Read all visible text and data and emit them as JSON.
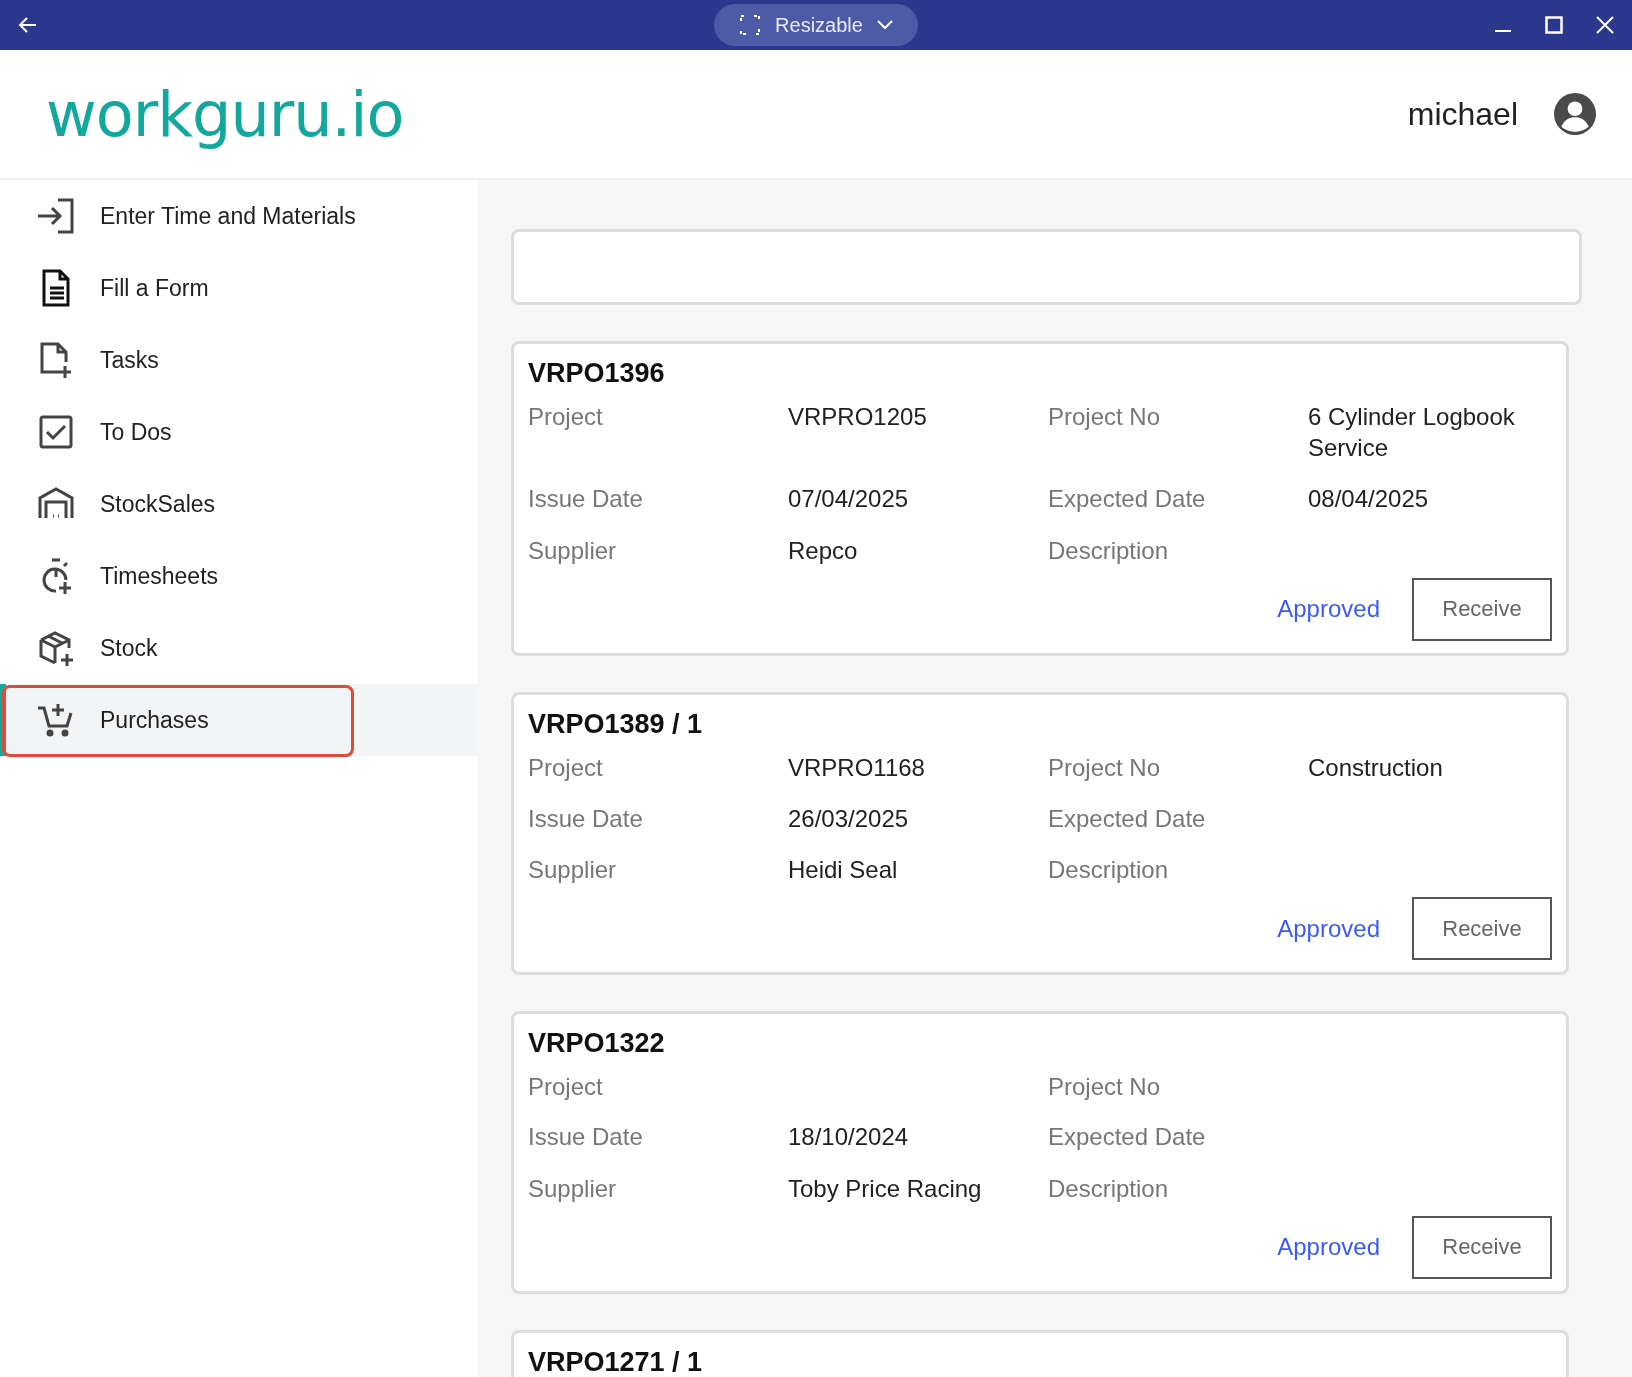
{
  "window": {
    "resize_mode": "Resizable"
  },
  "header": {
    "logo": "workguru.io",
    "user": "michael"
  },
  "sidebar": {
    "items": [
      {
        "label": "Enter Time and Materials",
        "selected": false
      },
      {
        "label": "Fill a Form",
        "selected": false
      },
      {
        "label": "Tasks",
        "selected": false
      },
      {
        "label": "To Dos",
        "selected": false
      },
      {
        "label": "StockSales",
        "selected": false
      },
      {
        "label": "Timesheets",
        "selected": false
      },
      {
        "label": "Stock",
        "selected": false
      },
      {
        "label": "Purchases",
        "selected": true
      }
    ]
  },
  "purchases": [
    {
      "title": "VRPO1396",
      "fields": [
        {
          "label": "Project",
          "value": "VRPRO1205"
        },
        {
          "label": "Project No",
          "value": "6 Cylinder Logbook Service"
        },
        {
          "label": "Issue Date",
          "value": "07/04/2025"
        },
        {
          "label": "Expected Date",
          "value": "08/04/2025"
        },
        {
          "label": "Supplier",
          "value": "Repco"
        },
        {
          "label": "Description"
        }
      ],
      "status": "Approved",
      "action": "Receive"
    },
    {
      "title": "VRPO1389 / 1",
      "fields": [
        {
          "label": "Project",
          "value": "VRPRO1168"
        },
        {
          "label": "Project No",
          "value": "Construction"
        },
        {
          "label": "Issue Date",
          "value": "26/03/2025"
        },
        {
          "label": "Expected Date"
        },
        {
          "label": "Supplier",
          "value": "Heidi Seal"
        },
        {
          "label": "Description"
        }
      ],
      "status": "Approved",
      "action": "Receive"
    },
    {
      "title": "VRPO1322",
      "fields": [
        {
          "label": "Project"
        },
        {
          "label": "Project No"
        },
        {
          "label": "Issue Date",
          "value": "18/10/2024"
        },
        {
          "label": "Expected Date"
        },
        {
          "label": "Supplier",
          "value": "Toby Price Racing"
        },
        {
          "label": "Description"
        }
      ],
      "status": "Approved",
      "action": "Receive"
    },
    {
      "title": "VRPO1271 / 1"
    }
  ]
}
